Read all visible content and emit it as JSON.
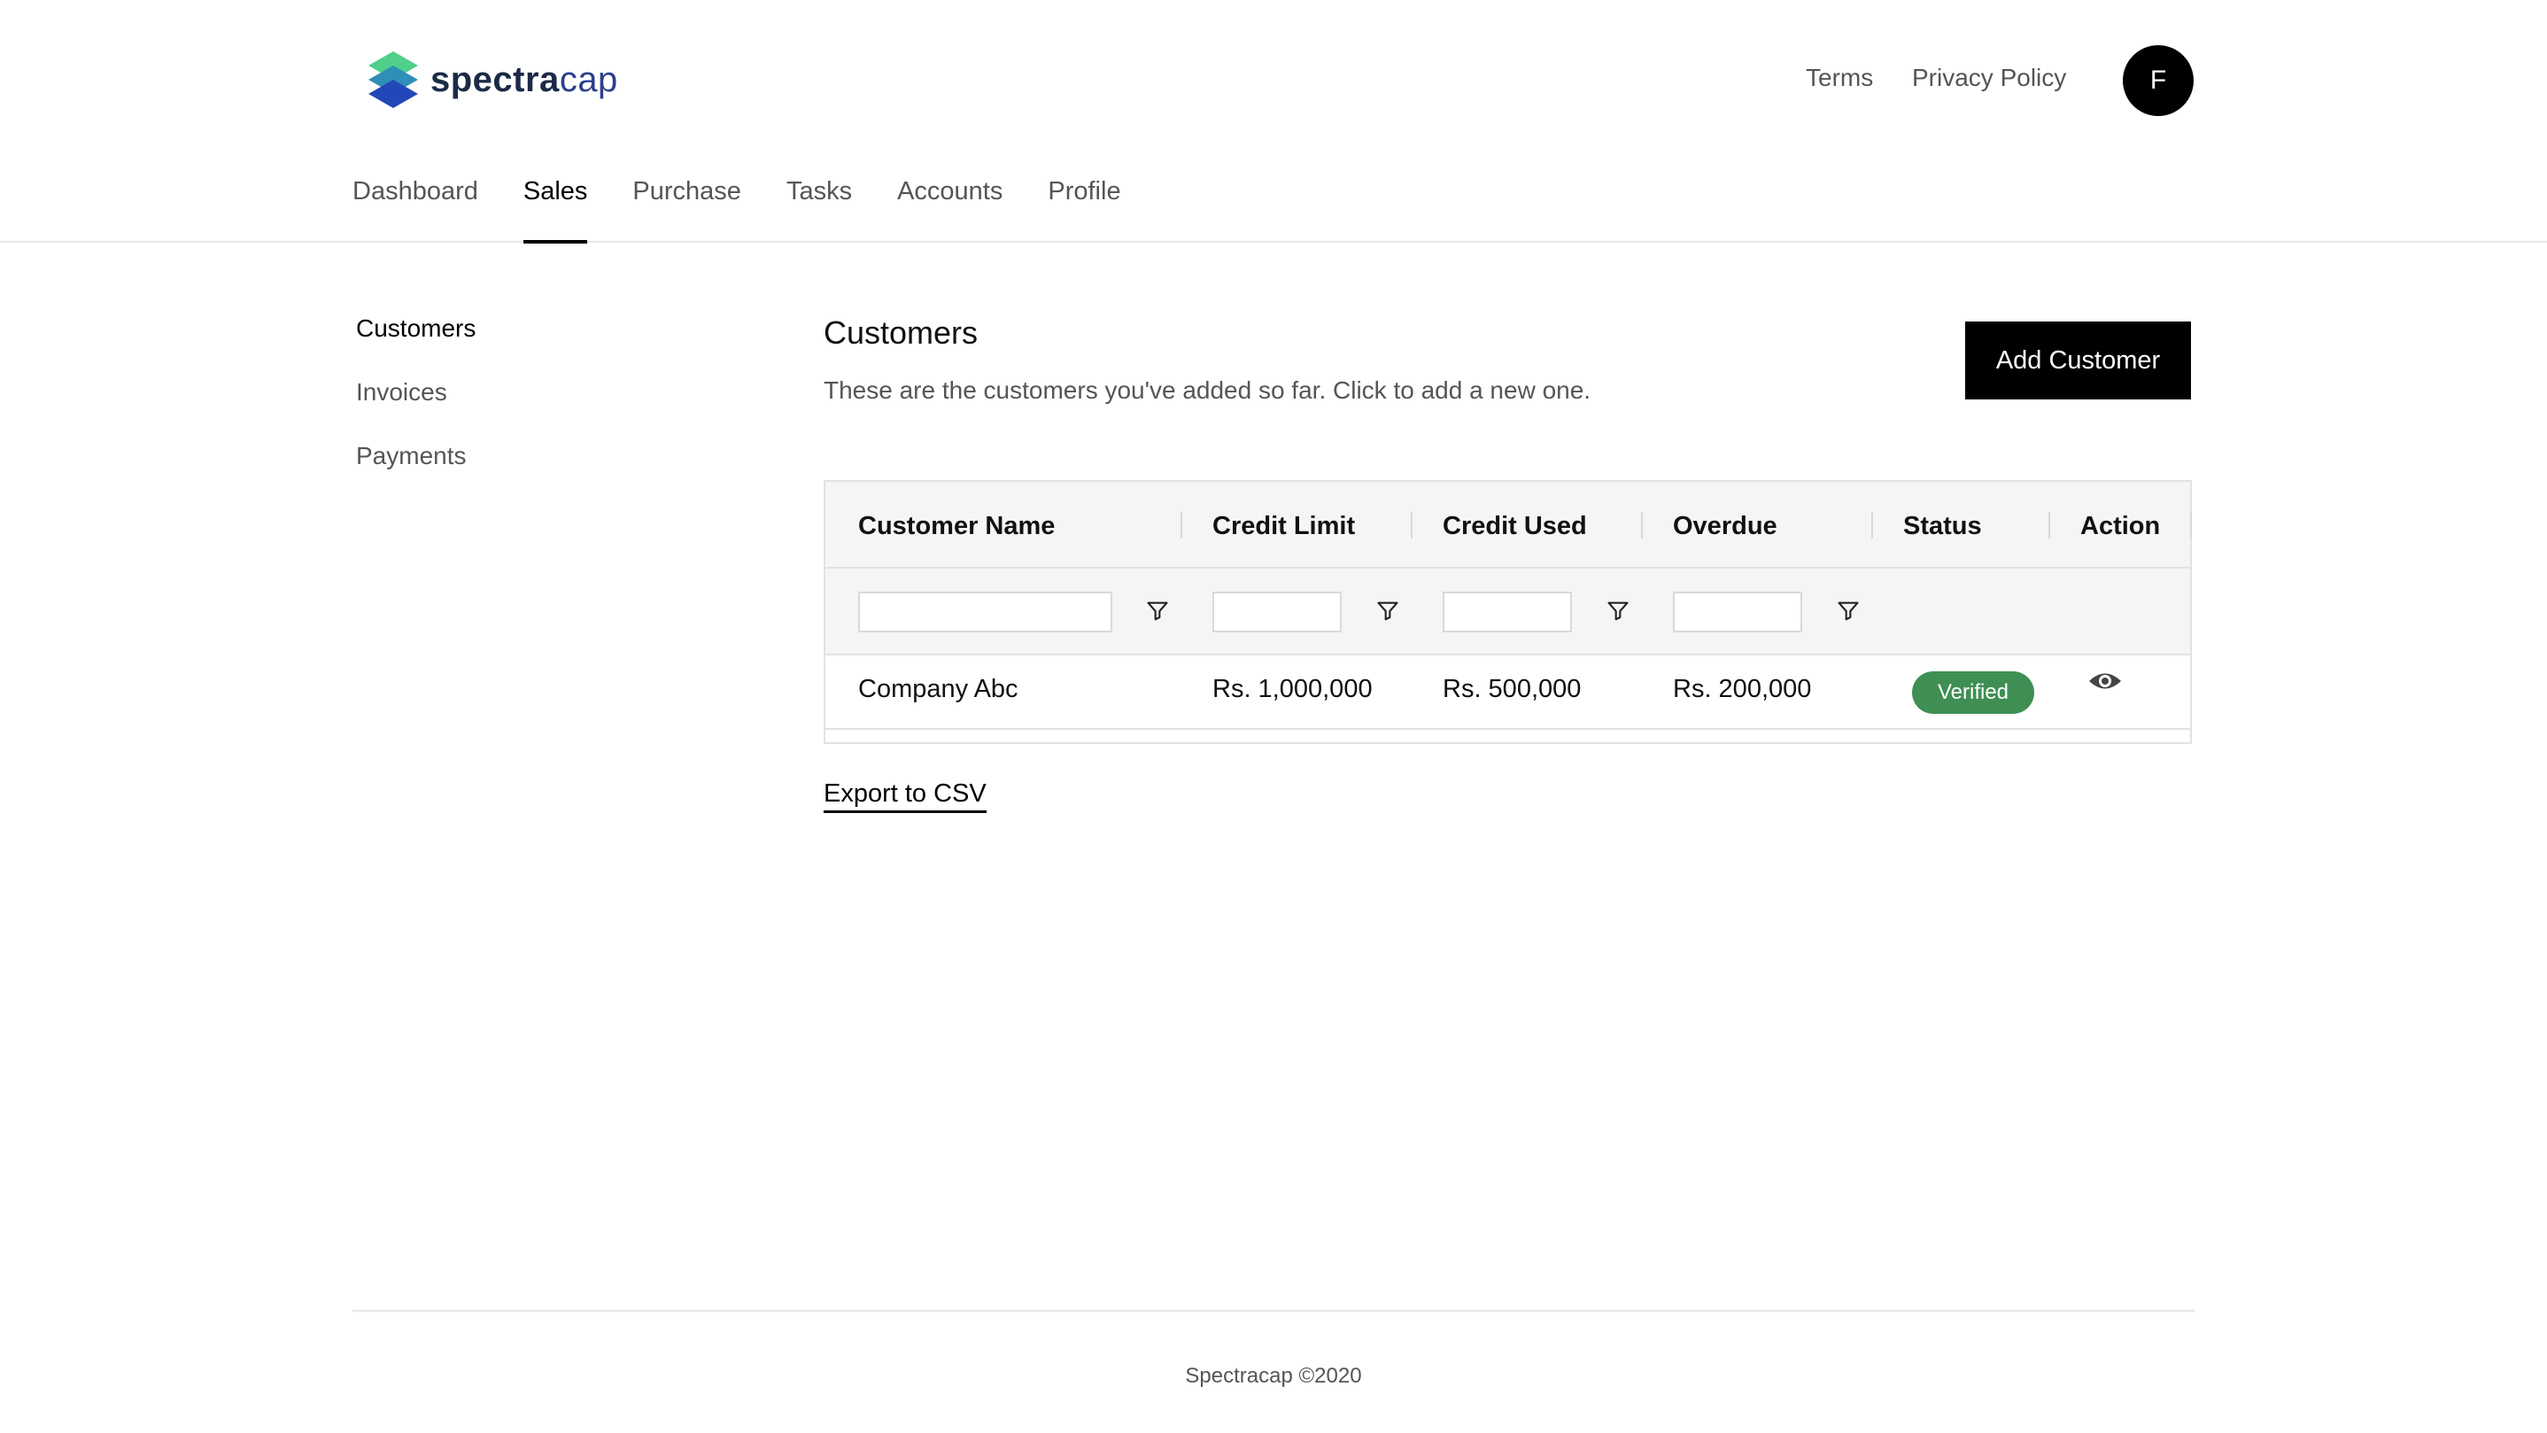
{
  "brand": {
    "name_bold": "spectra",
    "name_light": "cap"
  },
  "top_links": {
    "terms": "Terms",
    "privacy": "Privacy Policy"
  },
  "user": {
    "avatar_initial": "F"
  },
  "nav_tabs": [
    {
      "label": "Dashboard"
    },
    {
      "label": "Sales",
      "active": true
    },
    {
      "label": "Purchase"
    },
    {
      "label": "Tasks"
    },
    {
      "label": "Accounts"
    },
    {
      "label": "Profile"
    }
  ],
  "sidebar": {
    "items": [
      {
        "label": "Customers",
        "active": true
      },
      {
        "label": "Invoices"
      },
      {
        "label": "Payments"
      }
    ]
  },
  "main": {
    "title": "Customers",
    "subtitle": "These are the customers you've added so far. Click to add a new one.",
    "add_button": "Add Customer",
    "export_link": "Export to CSV"
  },
  "table": {
    "columns": [
      "Customer Name",
      "Credit Limit",
      "Credit Used",
      "Overdue",
      "Status",
      "Action"
    ],
    "rows": [
      {
        "name": "Company Abc",
        "credit_limit": "Rs. 1,000,000",
        "credit_used": "Rs. 500,000",
        "overdue": "Rs. 200,000",
        "status": "Verified",
        "action_icon": "eye-icon"
      }
    ]
  },
  "filter_icon": "filter-icon",
  "colors": {
    "status_verified": "#3f8f54",
    "primary": "#000000"
  },
  "footer": {
    "text": "Spectracap ©2020"
  }
}
